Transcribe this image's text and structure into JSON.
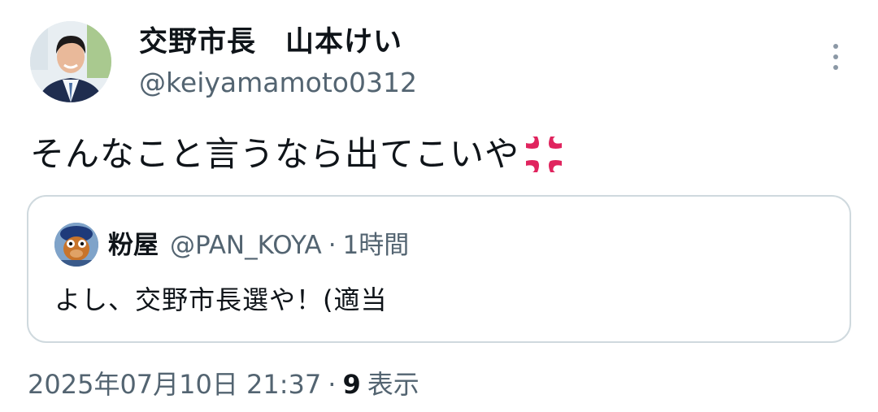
{
  "author": {
    "display_name": "交野市長　山本けい",
    "handle": "@keiyamamoto0312",
    "avatar_icon": "man-in-suit-photo"
  },
  "more_icon": "more-vertical-icon",
  "tweet": {
    "text": "そんなこと言うなら出てこいや",
    "emoji": "anger-symbol-emoji",
    "emoji_color": "#e0245e"
  },
  "quote": {
    "display_name": "粉屋",
    "handle": "@PAN_KOYA",
    "separator": "·",
    "time": "1時間",
    "text": "よし、交野市長選や！(適当",
    "avatar_icon": "mascot-avatar"
  },
  "footer": {
    "timestamp": "2025年07月10日 21:37",
    "separator": "·",
    "views_count": "9",
    "views_label": "表示"
  }
}
